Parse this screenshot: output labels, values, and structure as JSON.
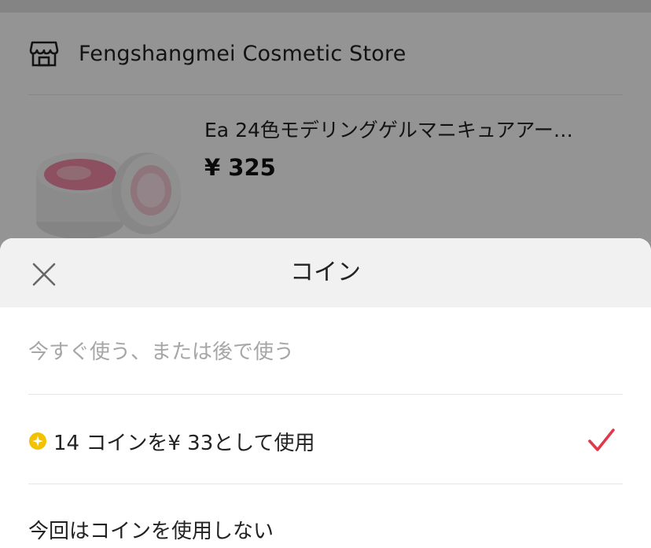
{
  "store": {
    "name": "Fengshangmei Cosmetic Store"
  },
  "product": {
    "title": "Ea 24色モデリングゲルマニキュアアー…",
    "price": "¥ 325",
    "image_icon": "gel-jar-image"
  },
  "sheet": {
    "title": "コイン",
    "hint": "今すぐ使う、または後で使う",
    "options": [
      {
        "label": "14 コインを¥ 33として使用",
        "selected": true,
        "icon": "coin-icon"
      },
      {
        "label": "今回はコインを使用しない",
        "selected": false
      }
    ]
  },
  "colors": {
    "check_accent": "#e0394b",
    "coin_yellow": "#f2c200"
  }
}
